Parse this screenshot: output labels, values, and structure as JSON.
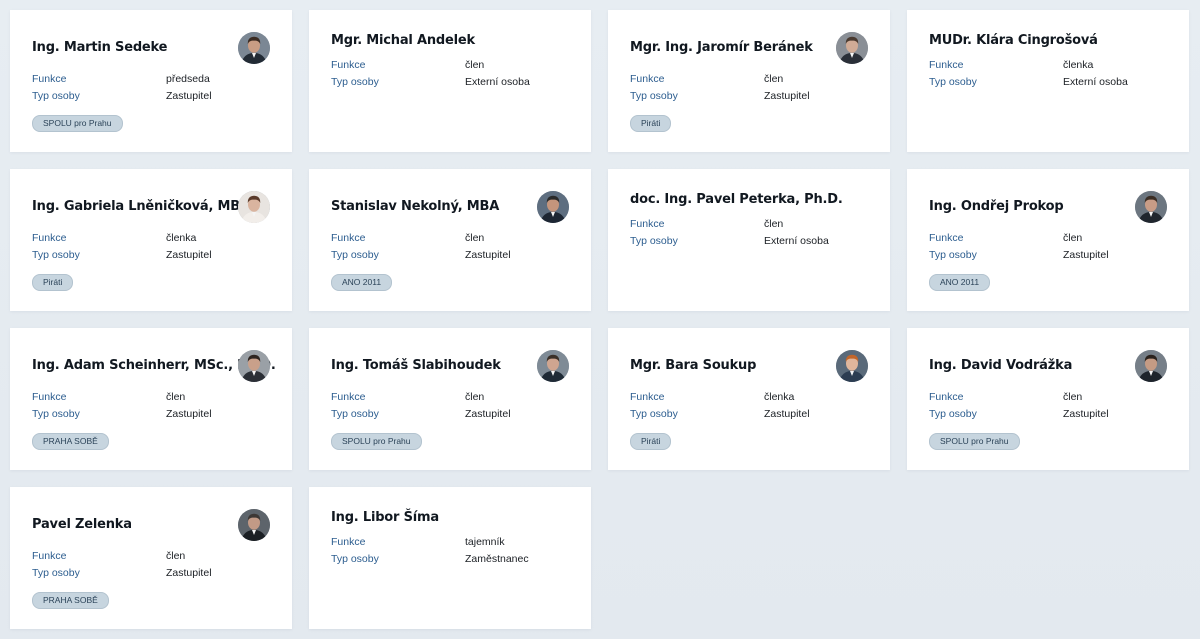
{
  "labels": {
    "funkce": "Funkce",
    "typ_osoby": "Typ osoby"
  },
  "people": [
    {
      "name": "Ing. Martin Sedeke",
      "funkce": "předseda",
      "typ": "Zastupitel",
      "party": "SPOLU pro Prahu",
      "photo": true,
      "skin": "#c99d84",
      "hair": "#3b2b22",
      "bg": "#7b8794",
      "shirt": "#222b35"
    },
    {
      "name": "Mgr. Michal Andelek",
      "funkce": "člen",
      "typ": "Externí osoba",
      "party": "",
      "photo": false
    },
    {
      "name": "Mgr. Ing. Jaromír Beránek",
      "funkce": "člen",
      "typ": "Zastupitel",
      "party": "Piráti",
      "photo": true,
      "skin": "#d0ab96",
      "hair": "#4a3a30",
      "bg": "#8a8f96",
      "shirt": "#2a2f38"
    },
    {
      "name": "MUDr. Klára Cingrošová",
      "funkce": "členka",
      "typ": "Externí osoba",
      "party": "",
      "photo": false
    },
    {
      "name": "Ing. Gabriela Lněničková, MBA",
      "funkce": "členka",
      "typ": "Zastupitel",
      "party": "Piráti",
      "photo": true,
      "skin": "#d9b49f",
      "hair": "#5a3a2a",
      "bg": "#e8e4e0",
      "shirt": "#f2eeea"
    },
    {
      "name": "Stanislav Nekolný, MBA",
      "funkce": "člen",
      "typ": "Zastupitel",
      "party": "ANO 2011",
      "photo": true,
      "skin": "#c4957c",
      "hair": "#2a2a2a",
      "bg": "#5e6e80",
      "shirt": "#1d2633"
    },
    {
      "name": "doc. Ing. Pavel Peterka, Ph.D.",
      "funkce": "člen",
      "typ": "Externí osoba",
      "party": "",
      "photo": false
    },
    {
      "name": "Ing. Ondřej Prokop",
      "funkce": "člen",
      "typ": "Zastupitel",
      "party": "ANO 2011",
      "photo": true,
      "skin": "#c89c86",
      "hair": "#3b2e25",
      "bg": "#6c7680",
      "shirt": "#20262e"
    },
    {
      "name": "Ing. Adam Scheinherr, MSc., Ph.D.",
      "funkce": "člen",
      "typ": "Zastupitel",
      "party": "PRAHA SOBĚ",
      "photo": true,
      "skin": "#c9a08a",
      "hair": "#2e2520",
      "bg": "#9aa0a6",
      "shirt": "#2b2f36"
    },
    {
      "name": "Ing. Tomáš Slabihoudek",
      "funkce": "člen",
      "typ": "Zastupitel",
      "party": "SPOLU pro Prahu",
      "photo": true,
      "skin": "#cfa590",
      "hair": "#3a3028",
      "bg": "#7f8b96",
      "shirt": "#1f2a36"
    },
    {
      "name": "Mgr. Bara Soukup",
      "funkce": "členka",
      "typ": "Zastupitel",
      "party": "Piráti",
      "photo": true,
      "skin": "#e0b69c",
      "hair": "#c2662a",
      "bg": "#5a6a7a",
      "shirt": "#2c3d52"
    },
    {
      "name": "Ing. David Vodrážka",
      "funkce": "člen",
      "typ": "Zastupitel",
      "party": "SPOLU pro Prahu",
      "photo": true,
      "skin": "#c49b84",
      "hair": "#2a221d",
      "bg": "#767f88",
      "shirt": "#1e242c"
    },
    {
      "name": "Pavel Zelenka",
      "funkce": "člen",
      "typ": "Zastupitel",
      "party": "PRAHA SOBĚ",
      "photo": true,
      "skin": "#c29a86",
      "hair": "#3d3835",
      "bg": "#5d646b",
      "shirt": "#1b1f24"
    },
    {
      "name": "Ing. Libor Šíma",
      "funkce": "tajemník",
      "typ": "Zaměstnanec",
      "party": "",
      "photo": false
    }
  ]
}
